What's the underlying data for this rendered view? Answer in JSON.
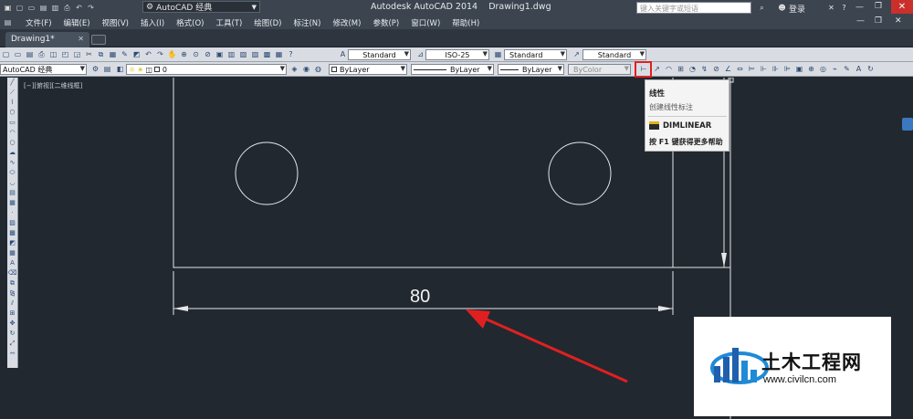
{
  "title_bar": {
    "workspace": "AutoCAD 经典",
    "title": "Autodesk AutoCAD 2014",
    "filename": "Drawing1.dwg",
    "search_placeholder": "键入关键字或短语",
    "login": "登录"
  },
  "menu": [
    "文件(F)",
    "编辑(E)",
    "视图(V)",
    "插入(I)",
    "格式(O)",
    "工具(T)",
    "绘图(D)",
    "标注(N)",
    "修改(M)",
    "参数(P)",
    "窗口(W)",
    "帮助(H)"
  ],
  "tabs": {
    "active": "Drawing1*"
  },
  "styles_toolbar": {
    "text_style": "Standard",
    "dim_style": "ISO-25",
    "table_style": "Standard",
    "multileader_style": "Standard"
  },
  "properties_toolbar": {
    "workspace": "AutoCAD 经典",
    "layer": "0",
    "color": "ByLayer",
    "linetype": "ByLayer",
    "lineweight": "ByLayer",
    "plot_style": "ByColor"
  },
  "viewport_label": "[−][俯视][二维线框]",
  "drawing": {
    "dimension_text": "80"
  },
  "tooltip": {
    "title": "线性",
    "description": "创建线性标注",
    "command": "DIMLINEAR",
    "help": "按 F1 键获得更多帮助"
  },
  "watermark": {
    "name": "土木工程网",
    "url": "www.civilcn.com"
  },
  "colors": {
    "canvas": "#212830",
    "annotation_red": "#e02020",
    "chrome": "#3b444f"
  }
}
